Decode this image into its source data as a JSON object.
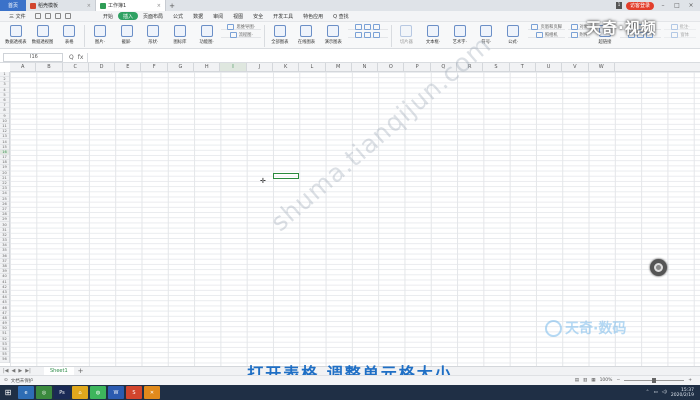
{
  "tabbar": {
    "home": "首页",
    "tabs": [
      {
        "label": "稻壳模板",
        "color": "#d2452d",
        "active": false
      },
      {
        "label": "工作簿1",
        "color": "#2f9d56",
        "active": true
      }
    ],
    "add": "+",
    "login": "访客登录"
  },
  "menubar": {
    "file": "三 文件",
    "items": [
      "开始",
      "插入",
      "页面布局",
      "公式",
      "数据",
      "审阅",
      "视图",
      "安全",
      "开发工具",
      "特色应用",
      "Q 查找"
    ],
    "active_index": 1
  },
  "ribbon": {
    "buttons": [
      {
        "label": "数据透视表"
      },
      {
        "label": "数据透视图"
      },
      {
        "label": "表格"
      },
      {
        "label": "图片·"
      },
      {
        "label": "截屏·"
      },
      {
        "label": "形状·"
      },
      {
        "label": "图标库"
      },
      {
        "label": "功能图·"
      }
    ],
    "small": [
      {
        "label": "思维导图·"
      },
      {
        "label": "流程图·"
      }
    ],
    "charts": [
      {
        "label": "全部图表"
      },
      {
        "label": "在线图表"
      },
      {
        "label": "演示图表"
      }
    ],
    "insert": [
      {
        "label": "切片器"
      },
      {
        "label": "文本框·"
      },
      {
        "label": "艺术字·"
      },
      {
        "label": "符号·"
      },
      {
        "label": "公式·"
      }
    ],
    "header_items": [
      {
        "label": "页眉和页脚"
      },
      {
        "label": "照相机"
      }
    ],
    "extra": [
      {
        "label": "对象"
      },
      {
        "label": "附件"
      },
      {
        "label": "超链接"
      }
    ],
    "right": [
      {
        "label": "批注·"
      },
      {
        "label": "窗体"
      }
    ]
  },
  "formulabar": {
    "namebox": "I16",
    "icons": [
      "Q",
      "fx"
    ],
    "value": ""
  },
  "grid": {
    "columns": [
      "A",
      "B",
      "C",
      "D",
      "E",
      "F",
      "G",
      "H",
      "I",
      "J",
      "K",
      "L",
      "M",
      "N",
      "O",
      "P",
      "Q",
      "R",
      "S",
      "T",
      "U",
      "V",
      "W"
    ],
    "selected_column": "I",
    "rows": [
      "1",
      "2",
      "3",
      "4",
      "5",
      "6",
      "7",
      "8",
      "9",
      "10",
      "11",
      "12",
      "13",
      "14",
      "15",
      "16",
      "17",
      "18",
      "19",
      "20",
      "21",
      "22",
      "23",
      "24",
      "25",
      "26",
      "27",
      "28",
      "29",
      "30",
      "31",
      "32",
      "33",
      "34",
      "35",
      "36",
      "37",
      "38",
      "39",
      "40",
      "41",
      "42",
      "43",
      "44",
      "45",
      "46",
      "47",
      "48",
      "49",
      "50",
      "51",
      "52",
      "53",
      "54",
      "55",
      "56"
    ],
    "selected_row": "16",
    "active_cell": "I16"
  },
  "watermark": "shuma.tianqijun.com",
  "brand": {
    "top": "天奇·视频",
    "bottom": "天奇·数码"
  },
  "subtitle": "打开表格 调整单元格大小",
  "sheets": {
    "nav": [
      "|◀",
      "◀",
      "▶",
      "▶|"
    ],
    "tabs": [
      "Sheet1"
    ],
    "add": "+"
  },
  "status": {
    "left": "文档未保护",
    "zoom": "100%",
    "zoom_level": 0.5
  },
  "taskbar": {
    "apps": [
      {
        "label": "⊞",
        "color": "#2a3f5e"
      },
      {
        "label": "e",
        "color": "#2e6db5"
      },
      {
        "label": "◎",
        "color": "#3b8a3e"
      },
      {
        "label": "Ps",
        "color": "#1a2a55"
      },
      {
        "label": "⌂",
        "color": "#e0a81c"
      },
      {
        "label": "◍",
        "color": "#3db55c"
      },
      {
        "label": "W",
        "color": "#2b5bb0"
      },
      {
        "label": "S",
        "color": "#d2452d"
      },
      {
        "label": "✕",
        "color": "#e08a1c"
      }
    ],
    "time": "15:37",
    "date": "2020/2/19"
  }
}
